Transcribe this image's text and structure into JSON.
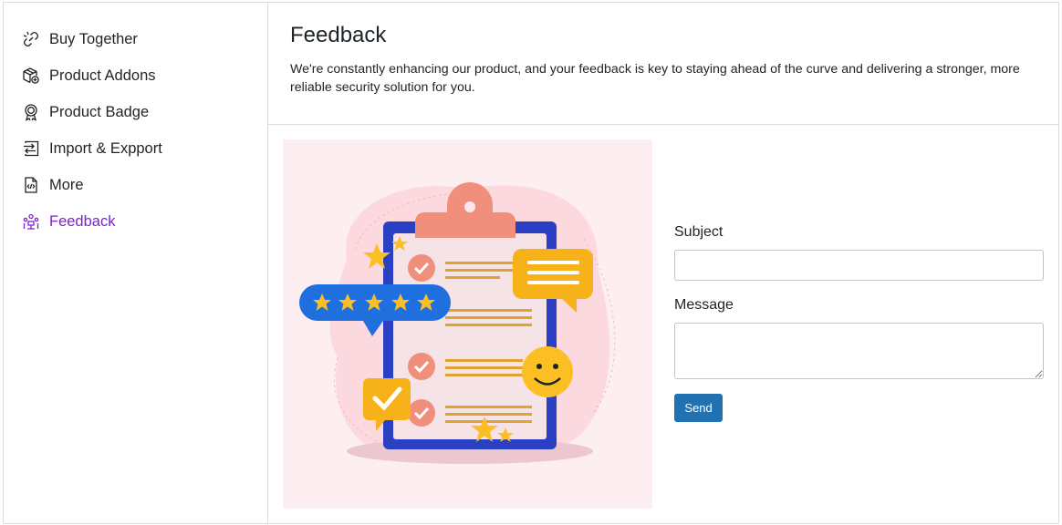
{
  "sidebar": {
    "items": [
      {
        "label": "Buy Together",
        "icon": "link-icon",
        "active": false
      },
      {
        "label": "Product Addons",
        "icon": "box-add-icon",
        "active": false
      },
      {
        "label": "Product Badge",
        "icon": "badge-icon",
        "active": false
      },
      {
        "label": "Import & Expport",
        "icon": "import-export-icon",
        "active": false
      },
      {
        "label": "More",
        "icon": "code-file-icon",
        "active": false
      },
      {
        "label": "Feedback",
        "icon": "feedback-icon",
        "active": true
      }
    ],
    "active_color": "#7e22ce"
  },
  "header": {
    "title": "Feedback",
    "description": "We're constantly enhancing our product, and your feedback is key to staying ahead of the curve and delivering a stronger, more reliable security solution for you."
  },
  "form": {
    "subject_label": "Subject",
    "subject_value": "",
    "message_label": "Message",
    "message_value": "",
    "send_label": "Send",
    "button_color": "#2271b1"
  },
  "illustration": {
    "name": "feedback-clipboard-illustration",
    "background": "#fdeef1"
  }
}
